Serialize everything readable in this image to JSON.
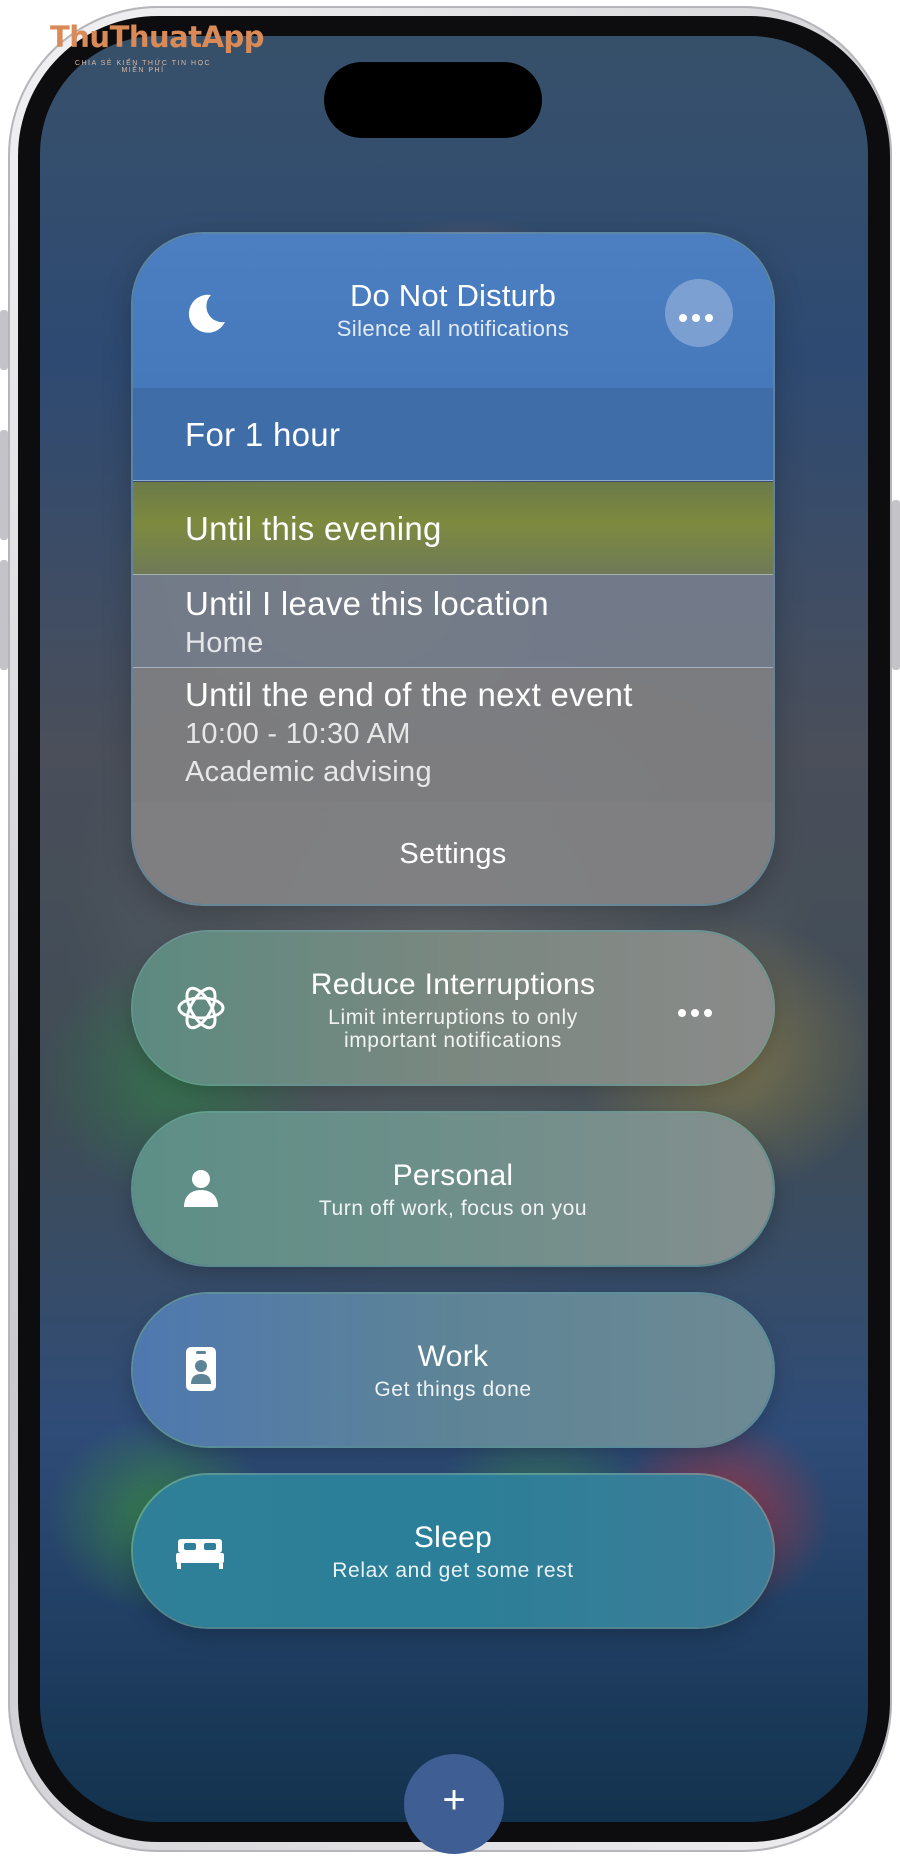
{
  "watermark": {
    "title": "ThuThuatApp",
    "subtitle": "CHIA SẺ KIẾN THỨC TIN HỌC MIỄN PHÍ"
  },
  "dnd": {
    "icon": "moon-icon",
    "title": "Do Not Disturb",
    "subtitle": "Silence all notifications",
    "more_icon": "ellipsis-icon",
    "options": [
      {
        "label": "For 1 hour"
      },
      {
        "label": "Until this evening"
      },
      {
        "label": "Until I leave this location",
        "detail": "Home"
      },
      {
        "label": "Until the end of the next event",
        "detail": "10:00 - 10:30 AM",
        "detail2": "Academic advising"
      }
    ],
    "settings_label": "Settings"
  },
  "focus_modes": [
    {
      "icon": "reduce-interruptions-icon",
      "title": "Reduce Interruptions",
      "subtitle_line1": "Limit interruptions to only",
      "subtitle_line2": "important notifications",
      "more_icon": "ellipsis-icon"
    },
    {
      "icon": "person-icon",
      "title": "Personal",
      "subtitle": "Turn off work, focus on you"
    },
    {
      "icon": "id-badge-icon",
      "title": "Work",
      "subtitle": "Get things done"
    },
    {
      "icon": "bed-icon",
      "title": "Sleep",
      "subtitle": "Relax and get some rest"
    }
  ],
  "add_button": {
    "icon": "plus-icon",
    "glyph": "+"
  },
  "colors": {
    "dnd_header": "#4c7fc2",
    "sleep_pill": "#2f7f98",
    "work_pill": "#4f78b0",
    "add_button": "#3e5e94"
  }
}
